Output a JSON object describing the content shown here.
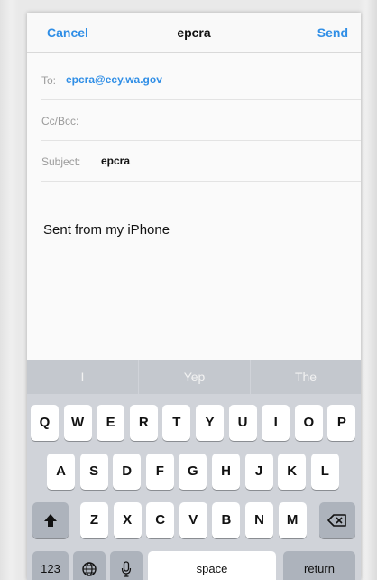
{
  "nav": {
    "cancel": "Cancel",
    "title": "epcra",
    "send": "Send"
  },
  "fields": {
    "to_label": "To:",
    "to_value": "epcra@ecy.wa.gov",
    "cc_label": "Cc/Bcc:",
    "subject_label": "Subject:",
    "subject_value": "epcra"
  },
  "body": {
    "signature": "Sent from my iPhone"
  },
  "keyboard": {
    "suggestions": [
      "I",
      "Yep",
      "The"
    ],
    "row1": [
      "Q",
      "W",
      "E",
      "R",
      "T",
      "Y",
      "U",
      "I",
      "O",
      "P"
    ],
    "row2": [
      "A",
      "S",
      "D",
      "F",
      "G",
      "H",
      "J",
      "K",
      "L"
    ],
    "row3": [
      "Z",
      "X",
      "C",
      "V",
      "B",
      "N",
      "M"
    ],
    "numbers_label": "123",
    "space_label": "space",
    "return_label": "return",
    "icons": {
      "shift": "shift-icon",
      "delete": "backspace-icon",
      "globe": "globe-icon",
      "mic": "microphone-icon"
    }
  }
}
